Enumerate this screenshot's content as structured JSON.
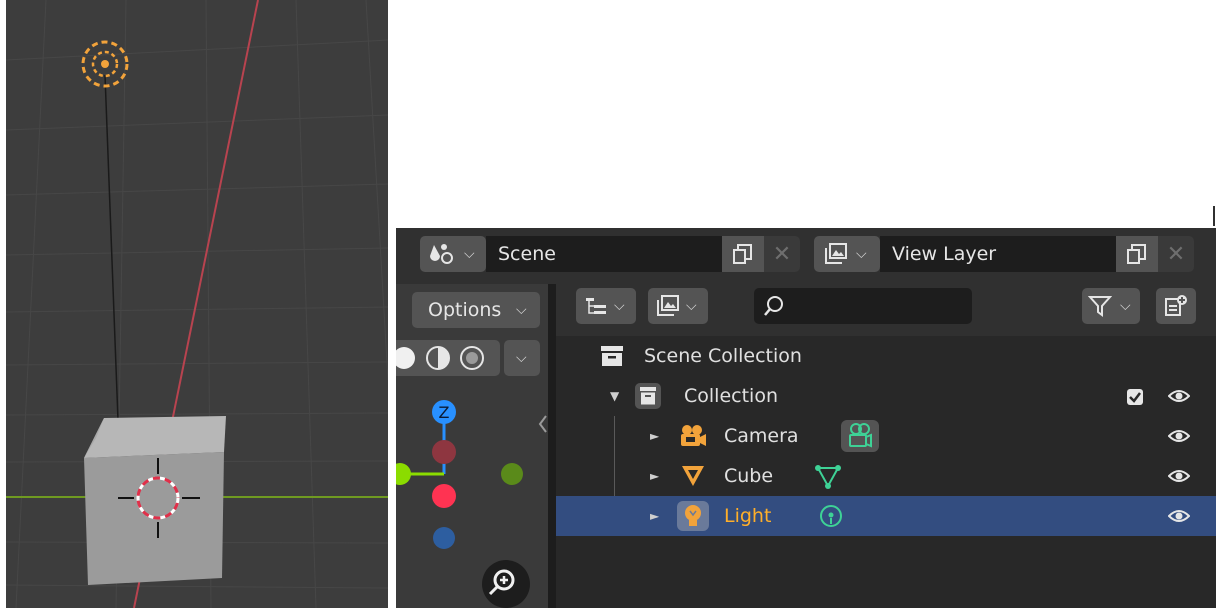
{
  "scene_selector": {
    "label": "Scene"
  },
  "view_layer_selector": {
    "label": "View Layer"
  },
  "viewport_header": {
    "options_label": "Options"
  },
  "outliner": {
    "search_placeholder": "",
    "scene_collection_label": "Scene Collection",
    "items": [
      {
        "label": "Collection"
      },
      {
        "label": "Camera"
      },
      {
        "label": "Cube"
      },
      {
        "label": "Light"
      }
    ]
  },
  "gizmo": {
    "z_label": "Z"
  },
  "colors": {
    "accent_orange": "#ffaf29",
    "selection_blue": "#334d80",
    "data_green": "#3ed296",
    "axis_red": "#ff3352",
    "axis_green": "#8bdc00",
    "axis_blue": "#2890ff"
  }
}
